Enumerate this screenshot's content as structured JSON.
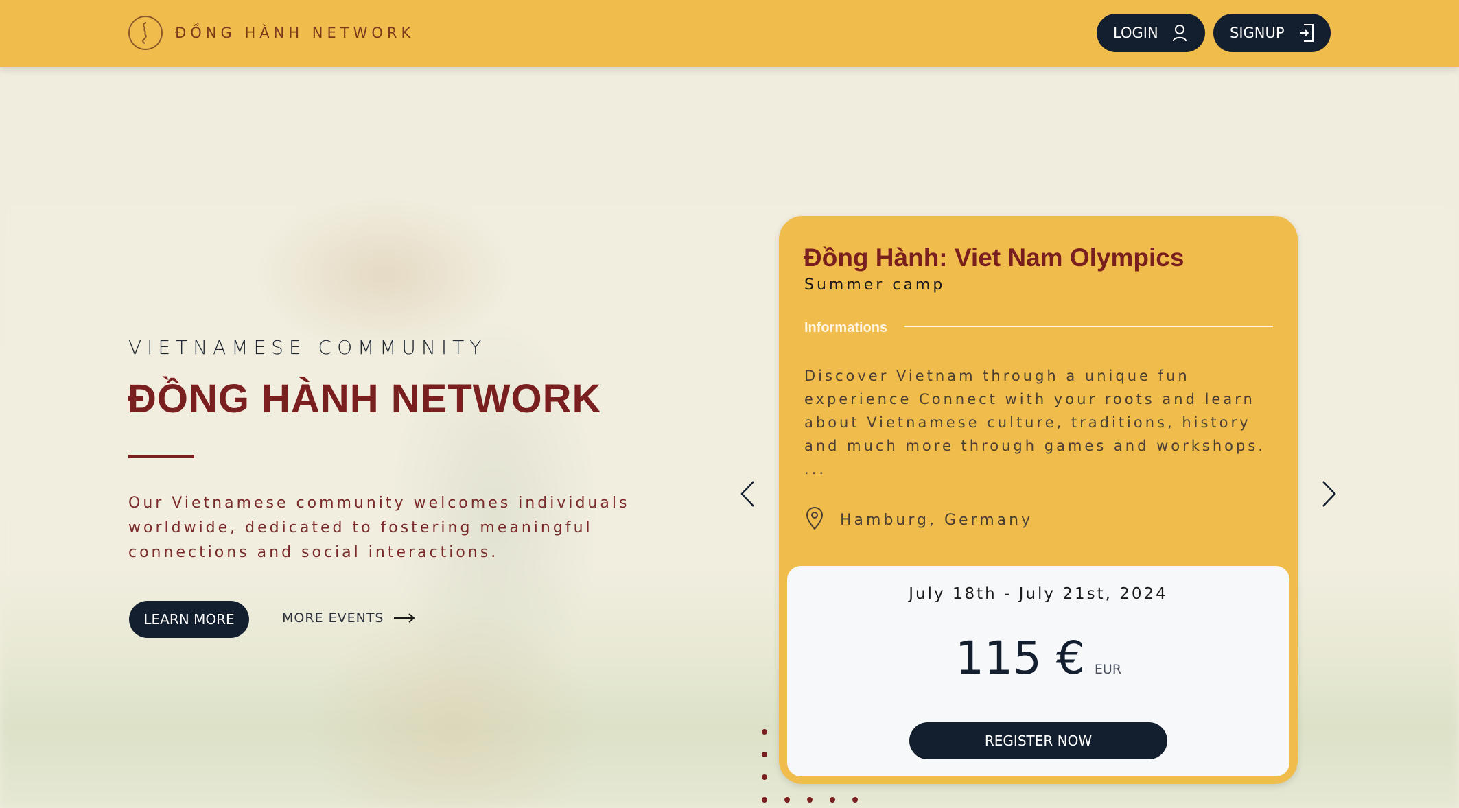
{
  "header": {
    "brand_name": "ĐỒNG HÀNH NETWORK",
    "login_label": "LOGIN",
    "signup_label": "SIGNUP"
  },
  "hero": {
    "eyebrow": "VIETNAMESE COMMUNITY",
    "title": "ĐỒNG HÀNH NETWORK",
    "description": "Our Vietnamese community welcomes individuals worldwide, dedicated to fostering meaningful connections and social interactions.",
    "learn_more_label": "LEARN MORE",
    "more_events_label": "MORE EVENTS"
  },
  "event": {
    "title": "Đồng Hành: Viet Nam Olympics",
    "subtitle": "Summer camp",
    "info_label": "Informations",
    "description": "Discover Vietnam through a unique fun experience Connect with your roots and learn about Vietnamese culture, traditions, history and much more through games and workshops. ...",
    "location": "Hamburg, Germany",
    "date_range": "July 18th - July 21st, 2024",
    "price": "115 €",
    "currency": "EUR",
    "register_label": "REGISTER NOW"
  },
  "colors": {
    "accent": "#f0bd4d",
    "brand_red": "#7a1f1f",
    "dark_button": "#131e2e"
  },
  "icons": {
    "logo": "vietnam-map-logo",
    "login": "user-icon",
    "signup": "sign-in-icon",
    "arrow": "arrow-right-icon",
    "prev": "chevron-left-icon",
    "next": "chevron-right-icon",
    "location": "map-pin-icon"
  }
}
